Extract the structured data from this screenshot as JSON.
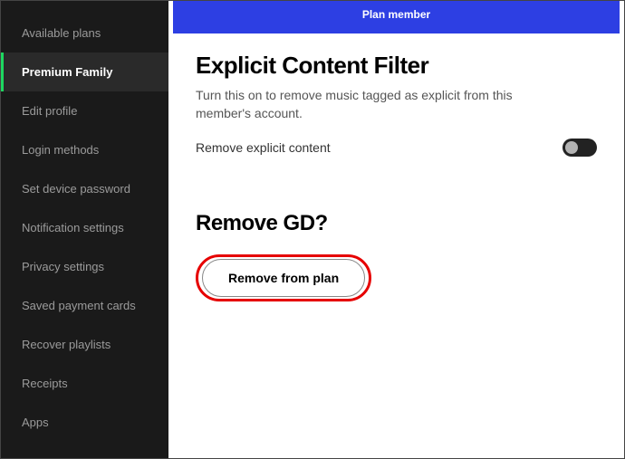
{
  "sidebar": {
    "items": [
      {
        "label": "Available plans"
      },
      {
        "label": "Premium Family"
      },
      {
        "label": "Edit profile"
      },
      {
        "label": "Login methods"
      },
      {
        "label": "Set device password"
      },
      {
        "label": "Notification settings"
      },
      {
        "label": "Privacy settings"
      },
      {
        "label": "Saved payment cards"
      },
      {
        "label": "Recover playlists"
      },
      {
        "label": "Receipts"
      },
      {
        "label": "Apps"
      }
    ],
    "active_index": 1
  },
  "header": {
    "title": "Plan member"
  },
  "explicit": {
    "title": "Explicit Content Filter",
    "description": "Turn this on to remove music tagged as explicit from this member's account.",
    "toggle_label": "Remove explicit content",
    "toggle_on": false
  },
  "remove": {
    "title": "Remove GD?",
    "button_label": "Remove from plan"
  },
  "highlight": {
    "color": "#e60000",
    "target": "remove-from-plan-button"
  }
}
